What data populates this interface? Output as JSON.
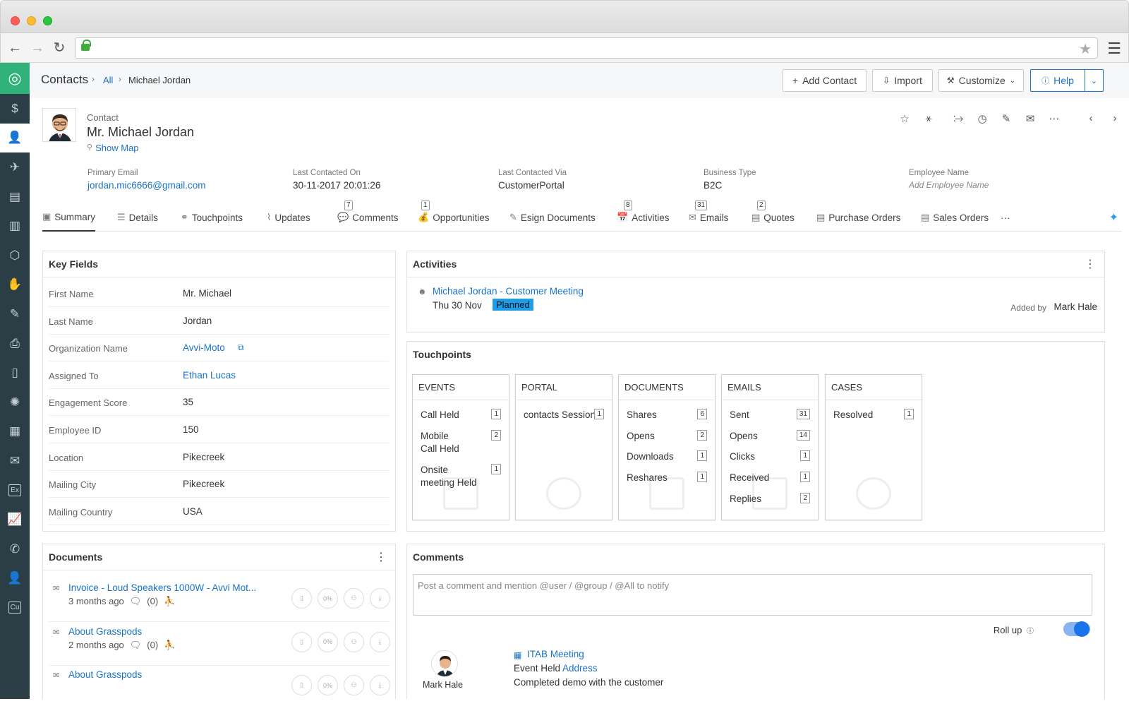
{
  "browser": {
    "url": ""
  },
  "sidebar": {
    "items": [
      {
        "name": "home-icon",
        "glyph": "◎"
      },
      {
        "name": "deals-icon",
        "glyph": "$"
      },
      {
        "name": "contacts-icon",
        "glyph": "👤"
      },
      {
        "name": "leads-icon",
        "glyph": "✈"
      },
      {
        "name": "documents-icon",
        "glyph": "▤"
      },
      {
        "name": "invoices-icon",
        "glyph": "▥"
      },
      {
        "name": "products-icon",
        "glyph": "⬡"
      },
      {
        "name": "campaigns-icon",
        "glyph": "✋"
      },
      {
        "name": "esign-icon",
        "glyph": "✎"
      },
      {
        "name": "print-icon",
        "glyph": "⎙"
      },
      {
        "name": "mobile-icon",
        "glyph": "▯"
      },
      {
        "name": "network-icon",
        "glyph": "✺"
      },
      {
        "name": "organizations-icon",
        "glyph": "▦"
      },
      {
        "name": "mail-icon",
        "glyph": "✉"
      },
      {
        "name": "ex-icon",
        "glyph": "Ex"
      },
      {
        "name": "reports-icon",
        "glyph": "📈"
      },
      {
        "name": "calls-icon",
        "glyph": "✆"
      },
      {
        "name": "user-check-icon",
        "glyph": "👤"
      },
      {
        "name": "cu-icon",
        "glyph": "Cu"
      }
    ]
  },
  "header": {
    "module": "Contacts",
    "filter": "All",
    "record": "Michael Jordan",
    "buttons": {
      "add_contact": "Add Contact",
      "import": "Import",
      "customize": "Customize",
      "help": "Help"
    }
  },
  "contact": {
    "type_label": "Contact",
    "full_name": "Mr. Michael Jordan",
    "show_map": "Show Map",
    "fields": [
      {
        "label": "Primary Email",
        "value": "jordan.mic6666@gmail.com",
        "kind": "link"
      },
      {
        "label": "Last Contacted On",
        "value": "30-11-2017 20:01:26",
        "kind": "text"
      },
      {
        "label": "Last Contacted Via",
        "value": "CustomerPortal",
        "kind": "text"
      },
      {
        "label": "Business Type",
        "value": "B2C",
        "kind": "text"
      },
      {
        "label": "Employee Name",
        "value": "Add Employee Name",
        "kind": "placeholder"
      }
    ]
  },
  "tabs": [
    {
      "label": "Summary",
      "badge": "",
      "icon": "▣"
    },
    {
      "label": "Details",
      "badge": "",
      "icon": "☰"
    },
    {
      "label": "Touchpoints",
      "badge": "",
      "icon": "⚭"
    },
    {
      "label": "Updates",
      "badge": "",
      "icon": "⌇"
    },
    {
      "label": "Comments",
      "badge": "7",
      "icon": "💬"
    },
    {
      "label": "Opportunities",
      "badge": "1",
      "icon": "💰"
    },
    {
      "label": "Esign Documents",
      "badge": "",
      "icon": "✎"
    },
    {
      "label": "Activities",
      "badge": "8",
      "icon": "📅"
    },
    {
      "label": "Emails",
      "badge": "31",
      "icon": "✉"
    },
    {
      "label": "Quotes",
      "badge": "2",
      "icon": "▤"
    },
    {
      "label": "Purchase Orders",
      "badge": "",
      "icon": "▤"
    },
    {
      "label": "Sales Orders",
      "badge": "",
      "icon": "▤"
    },
    {
      "label": "···",
      "badge": "",
      "icon": ""
    }
  ],
  "key_fields": {
    "title": "Key Fields",
    "rows": [
      {
        "label": "First Name",
        "value": "Mr. Michael",
        "kind": "text"
      },
      {
        "label": "Last Name",
        "value": "Jordan",
        "kind": "text"
      },
      {
        "label": "Organization Name",
        "value": "Avvi-Moto",
        "kind": "link"
      },
      {
        "label": "Assigned To",
        "value": "Ethan Lucas",
        "kind": "link"
      },
      {
        "label": "Engagement Score",
        "value": "35",
        "kind": "text"
      },
      {
        "label": "Employee ID",
        "value": "150",
        "kind": "text"
      },
      {
        "label": "Location",
        "value": "Pikecreek",
        "kind": "text"
      },
      {
        "label": "Mailing City",
        "value": "Pikecreek",
        "kind": "text"
      },
      {
        "label": "Mailing Country",
        "value": "USA",
        "kind": "text"
      }
    ]
  },
  "activities": {
    "title": "Activities",
    "item": {
      "title": "Michael Jordan - Customer Meeting",
      "date": "Thu 30 Nov",
      "status": "Planned",
      "added_by_label": "Added by",
      "added_by": "Mark Hale"
    }
  },
  "touchpoints": {
    "title": "Touchpoints",
    "cards": [
      {
        "title": "EVENTS",
        "rows": [
          {
            "label": "Call  Held",
            "count": "1"
          },
          {
            "label": "Mobile\nCall  Held",
            "count": "2"
          },
          {
            "label": "Onsite\nmeeting  Held",
            "count": "1"
          }
        ]
      },
      {
        "title": "PORTAL",
        "rows": [
          {
            "label": "contacts  Session",
            "count": "1"
          }
        ]
      },
      {
        "title": "DOCUMENTS",
        "rows": [
          {
            "label": "Shares",
            "count": "6"
          },
          {
            "label": "Opens",
            "count": "2"
          },
          {
            "label": "Downloads",
            "count": "1"
          },
          {
            "label": "Reshares",
            "count": "1"
          }
        ]
      },
      {
        "title": "EMAILS",
        "rows": [
          {
            "label": "Sent",
            "count": "31"
          },
          {
            "label": "Opens",
            "count": "14"
          },
          {
            "label": "Clicks",
            "count": "1"
          },
          {
            "label": "Received",
            "count": "1"
          },
          {
            "label": "Replies",
            "count": "2"
          }
        ]
      },
      {
        "title": "CASES",
        "rows": [
          {
            "label": "Resolved",
            "count": "1"
          }
        ]
      }
    ]
  },
  "documents": {
    "title": "Documents",
    "items": [
      {
        "title": "Invoice - Loud Speakers 1000W - Avvi Mot...",
        "age": "3 months ago",
        "comments": "(0)"
      },
      {
        "title": "About Grasspods",
        "age": "2 months ago",
        "comments": "(0)"
      },
      {
        "title": "About Grasspods",
        "age": "",
        "comments": ""
      }
    ],
    "progress_label": "0%"
  },
  "comments": {
    "title": "Comments",
    "placeholder": "Post a comment and mention @user / @group / @All to notify",
    "rollup_label": "Roll up",
    "entry": {
      "author": "Mark Hale",
      "title": "ITAB Meeting",
      "line_prefix": "Event Held",
      "line_link": "Address",
      "text": "Completed demo with the customer"
    }
  }
}
